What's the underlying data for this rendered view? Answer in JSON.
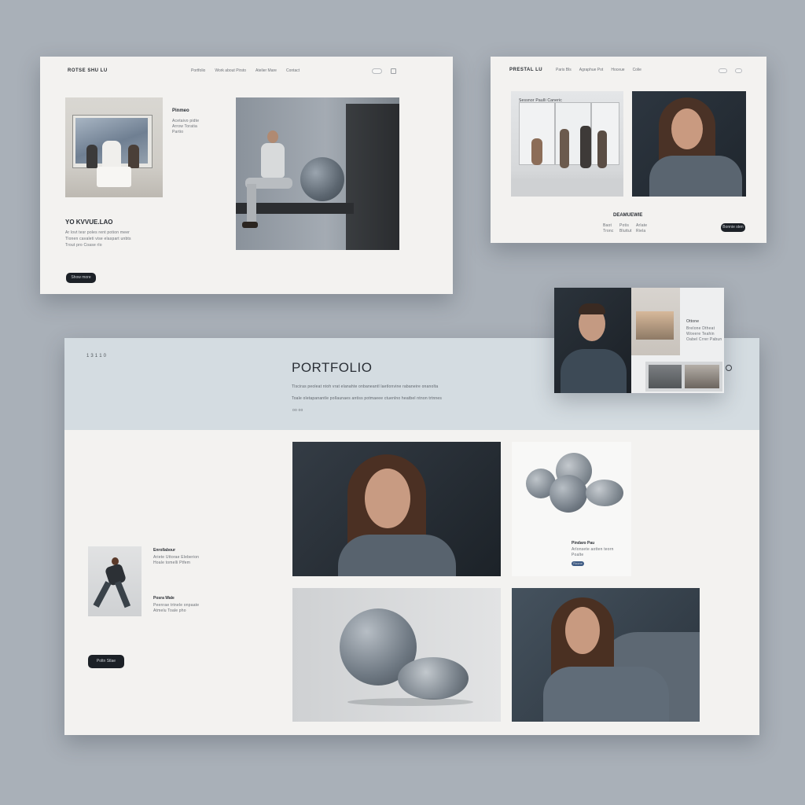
{
  "card_a": {
    "logo": "ROTSE SHU LU",
    "nav": [
      "Portfolio",
      "Work about Pirsto",
      "Atelier Mare",
      "Contact"
    ],
    "side_title": "Pinmeo",
    "side_text": [
      "Acetaivo pidte",
      "Arrow Toratia",
      "Partio"
    ],
    "name": "YO KVVUE.LAO",
    "body_lines": [
      "Ar lovt tesr poles rent potion meer",
      "Tlonen cavaleti vise elaspart unbts",
      "Trout pro Coase rlo"
    ],
    "button": "Show more"
  },
  "card_b": {
    "logo": "PRESTAL LU",
    "nav": [
      "Paris Bls",
      "Agraphue Pot",
      "Hoceue",
      "Colie"
    ],
    "gallery_caption": "Sessnor Paulli Caneric",
    "title": "DEAMUEWIE",
    "meta": [
      "Baot",
      "Potis",
      "Arlate",
      "Tronc",
      "Bluttut",
      "Riela"
    ],
    "button": "Bonnie sten"
  },
  "card_c": {
    "label": "Ottone",
    "text": [
      "Brelone Dtheat",
      "Wovere Teahin",
      "Oabel Crrer Pabun"
    ]
  },
  "card_d": {
    "index": "1 3 1 1 0",
    "title": "PORTFOLIO",
    "desc": [
      "Tlsciras peoleat ntoh vrat elanahte onbaneantl laetlonvine rabaneire onanolta",
      "Toale oletapanantle pollaunaes antiss potmaeee ctuenlno heatbel ntnon trtnnes"
    ],
    "dots": "oo  oo",
    "entry1_title": "Enrollabour",
    "entry1_text": [
      "Ariete Uttorae Eleberion",
      "Hoale tomelli Ptfem"
    ],
    "entry2_title": "Posra Wale",
    "entry2_text": [
      "Peenrae trtnele onpaate",
      "Atmelu Toale pho"
    ],
    "button": "Poltn Stlae",
    "stones_caption": "Pindaro Pau",
    "stones_text": [
      "Arlonsete aotten teorn",
      "Poalte"
    ],
    "stones_button": "Roone"
  },
  "colors": {
    "dark": "#1c2127",
    "page": "#a9b0b8",
    "card": "#f3f2f0",
    "band": "#d4dce1"
  }
}
